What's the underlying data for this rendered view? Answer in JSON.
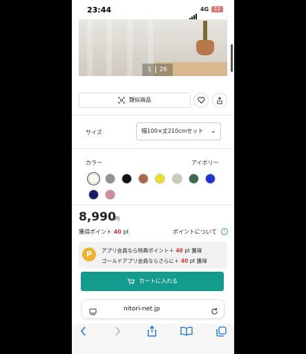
{
  "status_bar": {
    "time": "23:44",
    "network": "4G",
    "battery": "12"
  },
  "gallery": {
    "current": "1",
    "total": "26"
  },
  "actions": {
    "similar_label": "類似商品"
  },
  "size": {
    "label": "サイズ",
    "selected": "幅100×丈210cmセット"
  },
  "color": {
    "label": "カラー",
    "selected_name": "アイボリー",
    "swatches": [
      "#fbfaec",
      "#8f9493",
      "#111111",
      "#a86a4c",
      "#ecdf2b",
      "#c7cbb3",
      "#3b6b4c",
      "#1f2fd1",
      "#171b6a",
      "#cf8da0"
    ]
  },
  "price": {
    "amount": "8,990",
    "currency": "円"
  },
  "points": {
    "label": "獲得ポイント",
    "value": "40",
    "unit": "pt",
    "about": "ポイントについて"
  },
  "promo": {
    "coin": "P",
    "line1_text": "アプリ会員なら特典ポイント＋",
    "line1_value": "40",
    "line1_suffix": "pt 獲得",
    "line2_text": "ゴールドアプリ会員ならさらに＋",
    "line2_value": "40",
    "line2_suffix": "pt 獲得"
  },
  "cart_button": {
    "label": "カートに入れる"
  },
  "browser": {
    "url": "nitori-net.jp"
  },
  "colors": {
    "accent": "#139c8e",
    "point_red": "#d33333",
    "coin": "#f2b12a",
    "link_blue": "#3a8fd6"
  }
}
